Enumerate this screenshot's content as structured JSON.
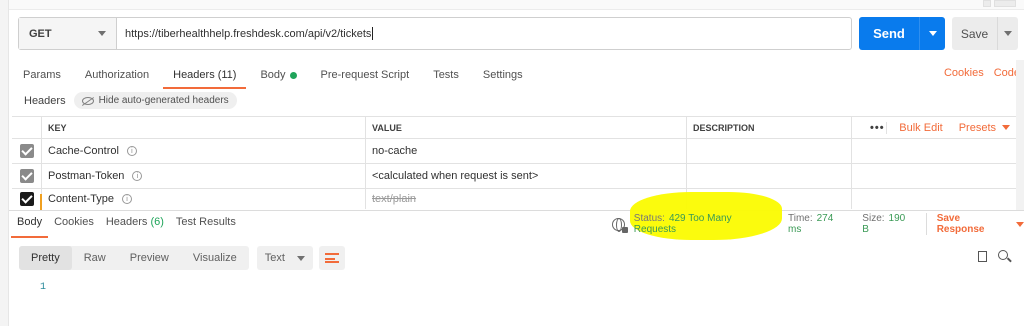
{
  "request": {
    "method": "GET",
    "url": "https://tiberhealthhelp.freshdesk.com/api/v2/tickets",
    "send_label": "Send",
    "save_label": "Save"
  },
  "request_tabs": [
    {
      "label": "Params"
    },
    {
      "label": "Authorization"
    },
    {
      "label": "Headers",
      "count": "(11)"
    },
    {
      "label": "Body"
    },
    {
      "label": "Pre-request Script"
    },
    {
      "label": "Tests"
    },
    {
      "label": "Settings"
    }
  ],
  "right_links": {
    "cookies": "Cookies",
    "code": "Code"
  },
  "headers_section": {
    "title": "Headers",
    "hide_label": "Hide auto-generated headers"
  },
  "table": {
    "columns": {
      "key": "KEY",
      "value": "VALUE",
      "description": "DESCRIPTION"
    },
    "dots": "•••",
    "bulk_edit": "Bulk Edit",
    "presets": "Presets",
    "rows": [
      {
        "key": "Cache-Control",
        "value": "no-cache"
      },
      {
        "key": "Postman-Token",
        "value": "<calculated when request is sent>"
      },
      {
        "key": "Content-Type",
        "value": "text/plain"
      }
    ]
  },
  "response_tabs": {
    "body": "Body",
    "cookies": "Cookies",
    "headers": "Headers",
    "headers_count": "(6)",
    "test_results": "Test Results"
  },
  "response_status": {
    "status_label": "Status:",
    "status_value": "429 Too Many Requests",
    "time_label": "Time:",
    "time_value": "274 ms",
    "size_label": "Size:",
    "size_value": "190 B",
    "save_response": "Save Response"
  },
  "response_toolbar": {
    "modes": [
      "Pretty",
      "Raw",
      "Preview",
      "Visualize"
    ],
    "format": "Text"
  },
  "editor": {
    "line_number": "1"
  },
  "colors": {
    "accent": "#f26b3a",
    "send": "#097bed",
    "success": "#3a9a55",
    "highlight": "#fbfb00"
  }
}
